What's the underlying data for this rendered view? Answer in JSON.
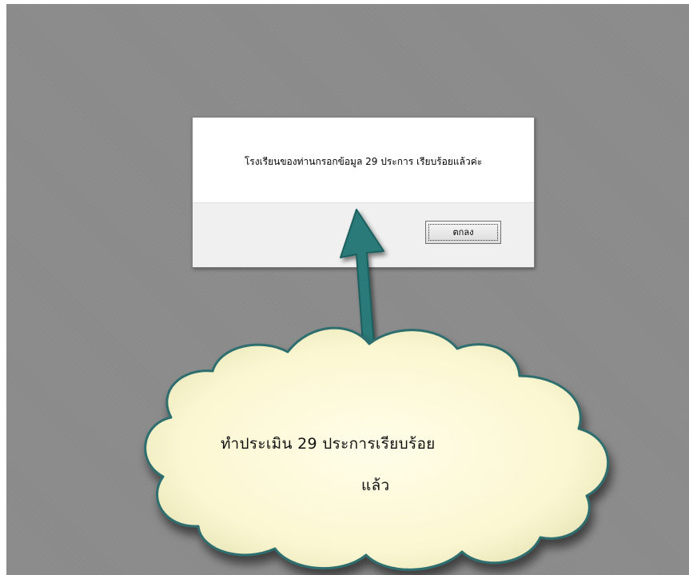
{
  "dialog": {
    "message": "โรงเรียนของท่านกรอกข้อมูล 29 ประการ เรียบร้อยแล้วค่ะ",
    "ok_label": "ตกลง"
  },
  "callout": {
    "line1": "ทำประเมิน   29 ประการเรียบร้อย",
    "line2": "แล้ว"
  },
  "colors": {
    "background": "#8a8a8a",
    "arrow": "#2a7a7a",
    "cloud_fill": "#fdfbe0",
    "cloud_stroke": "#2e6e6e"
  }
}
